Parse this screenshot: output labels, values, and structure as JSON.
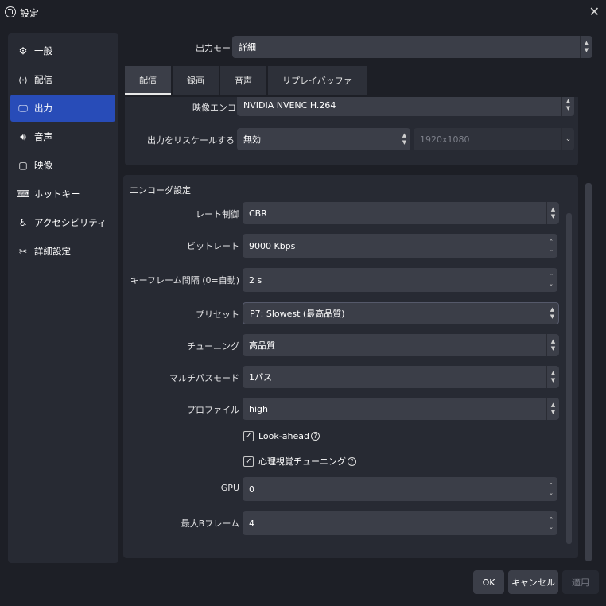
{
  "window": {
    "title": "設定"
  },
  "sidebar": {
    "items": [
      {
        "label": "一般",
        "icon": "gear-icon"
      },
      {
        "label": "配信",
        "icon": "broadcast-icon"
      },
      {
        "label": "出力",
        "icon": "output-icon",
        "active": true
      },
      {
        "label": "音声",
        "icon": "speaker-icon"
      },
      {
        "label": "映像",
        "icon": "monitor-icon"
      },
      {
        "label": "ホットキー",
        "icon": "keyboard-icon"
      },
      {
        "label": "アクセシビリティ",
        "icon": "accessibility-icon"
      },
      {
        "label": "詳細設定",
        "icon": "tools-icon"
      }
    ]
  },
  "output_mode": {
    "label": "出力モード",
    "value": "詳細"
  },
  "tabs": [
    {
      "label": "配信",
      "active": true
    },
    {
      "label": "録画"
    },
    {
      "label": "音声"
    },
    {
      "label": "リプレイバッファ"
    }
  ],
  "video_encoder": {
    "label": "映像エンコーダ",
    "value": "NVIDIA NVENC H.264"
  },
  "rescale": {
    "label": "出力をリスケールする",
    "value": "無効",
    "resolution": "1920x1080"
  },
  "encoder_settings": {
    "title": "エンコーダ設定",
    "rate_control": {
      "label": "レート制御",
      "value": "CBR"
    },
    "bitrate": {
      "label": "ビットレート",
      "value": "9000 Kbps"
    },
    "keyframe": {
      "label": "キーフレーム間隔 (0=自動)",
      "value": "2 s"
    },
    "preset": {
      "label": "プリセット",
      "value": "P7: Slowest (最高品質)"
    },
    "tuning": {
      "label": "チューニング",
      "value": "高品質"
    },
    "multipass": {
      "label": "マルチパスモード",
      "value": "1パス"
    },
    "profile": {
      "label": "プロファイル",
      "value": "high"
    },
    "lookahead": {
      "label": "Look-ahead",
      "checked": true
    },
    "psycho_visual": {
      "label": "心理視覚チューニング",
      "checked": true
    },
    "gpu": {
      "label": "GPU",
      "value": "0"
    },
    "max_bframes": {
      "label": "最大Bフレーム",
      "value": "4"
    }
  },
  "buttons": {
    "ok": "OK",
    "cancel": "キャンセル",
    "apply": "適用"
  },
  "colors": {
    "accent": "#284cb8",
    "background": "#1d1f26",
    "panel": "#272a33",
    "control": "#3b3e48"
  }
}
